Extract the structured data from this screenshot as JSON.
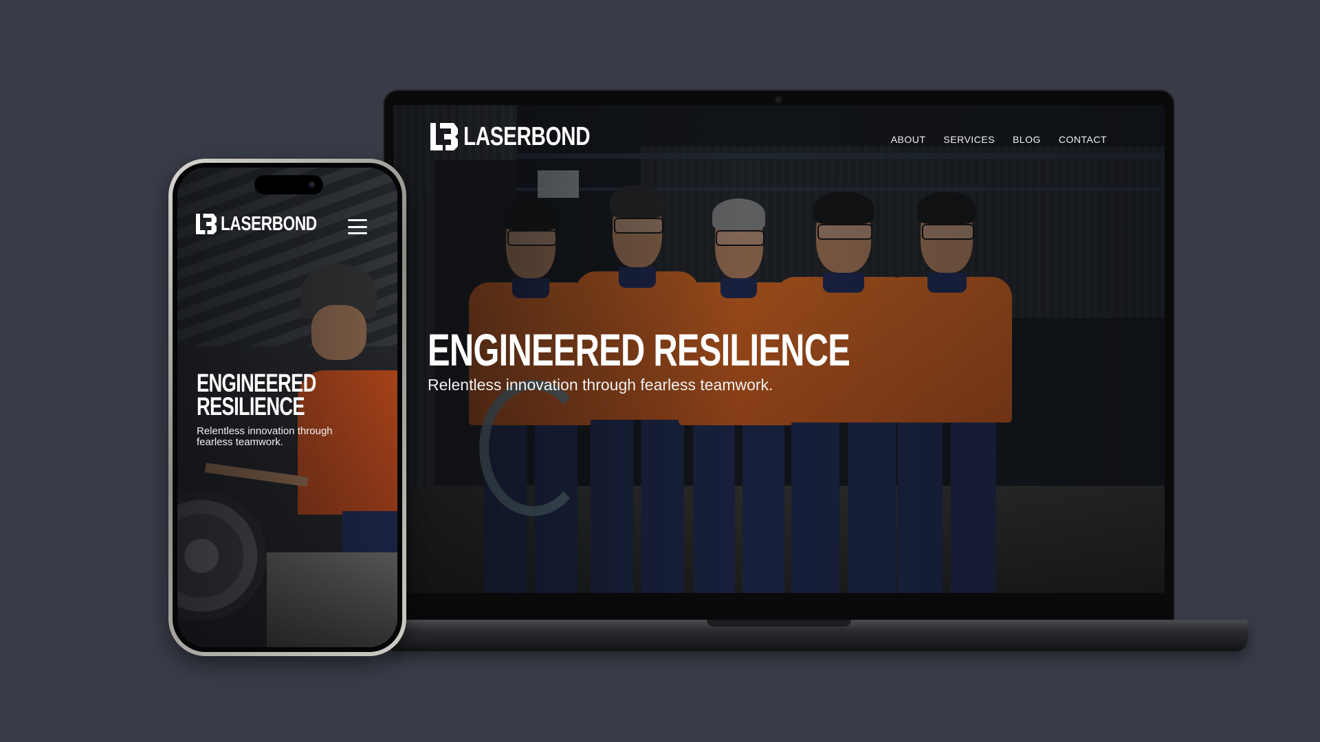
{
  "brand": {
    "logo_mark": "LB",
    "name": "LASERBOND"
  },
  "nav": {
    "items": [
      "ABOUT",
      "SERVICES",
      "BLOG",
      "CONTACT"
    ]
  },
  "hero": {
    "title": "ENGINEERED RESILIENCE",
    "title_mobile_line1": "ENGINEERED",
    "title_mobile_line2": "RESILIENCE",
    "subtitle": "Relentless innovation through fearless teamwork.",
    "subtitle_mobile_line1": "Relentless innovation through",
    "subtitle_mobile_line2": "fearless teamwork."
  },
  "colors": {
    "background": "#383c47",
    "hi_vis_orange": "#e16a1f",
    "navy": "#1e2a52",
    "text": "#ffffff"
  },
  "icons": {
    "menu": "hamburger-menu-icon"
  }
}
